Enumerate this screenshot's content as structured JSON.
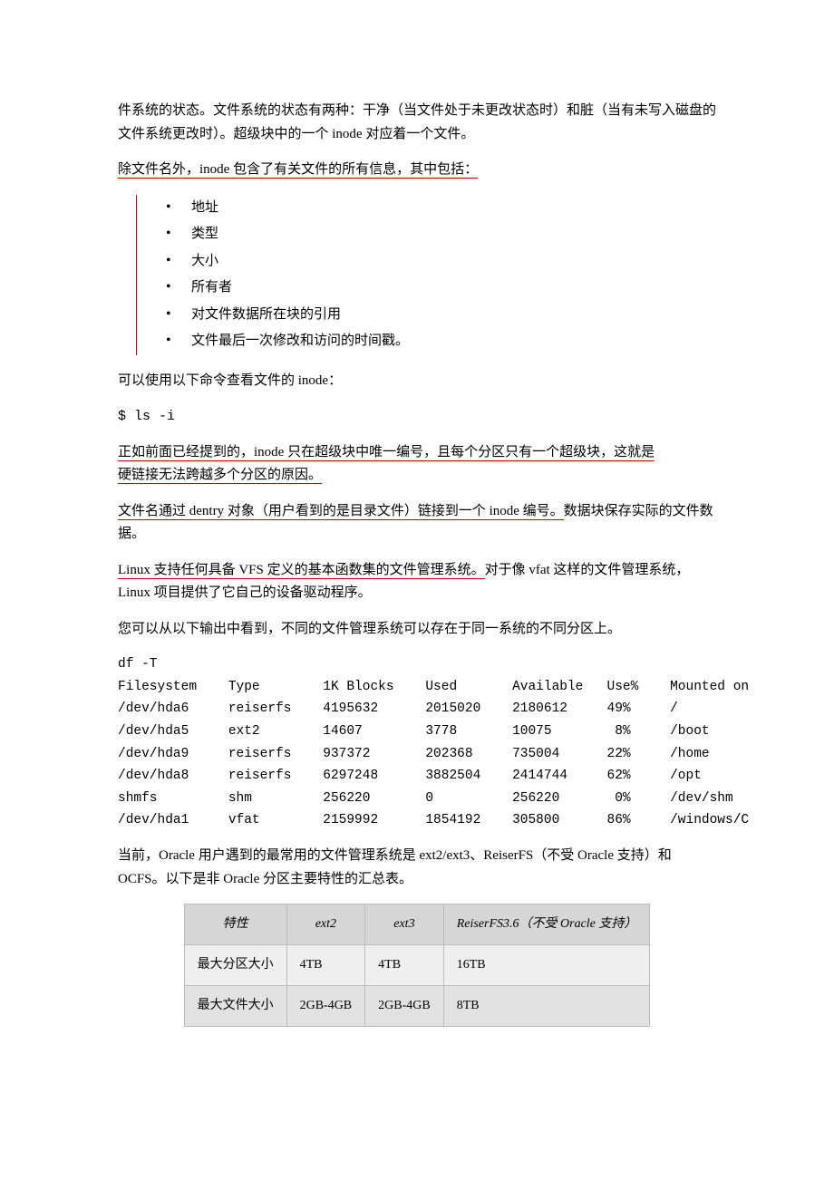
{
  "intro_para": "件系统的状态。文件系统的状态有两种：干净（当文件处于未更改状态时）和脏（当有未写入磁盘的文件系统更改时）。超级块中的一个 inode 对应着一个文件。",
  "inode_heading": "除文件名外，inode 包含了有关文件的所有信息，其中包括：",
  "inode_items": [
    "地址",
    "类型",
    "大小",
    "所有者",
    "对文件数据所在块的引用",
    "文件最后一次修改和访问的时间戳。"
  ],
  "cmd_intro": "可以使用以下命令查看文件的 inode：",
  "cmd_text": "$ ls -i",
  "para_unique_a": "正如前面已经提到的，inode 只在超级块中唯一编号，且每个分区只有一个超级块，这就是",
  "para_unique_b": "硬链接无法跨越多个分区的原因。",
  "para_dentry_a": "文件名通过 dentry 对象（用户看到的是目录文件）链接到一个 inode 编号。",
  "para_dentry_b": "数据块保存实际的文件数据。",
  "para_vfs_a": "Linux 支持任何具备 VFS 定义的基本函数集的文件管理系统。",
  "para_vfs_b": "对于像 vfat 这样的文件管理系统，Linux 项目提供了它自己的设备驱动程序。",
  "para_df_intro": "您可以从以下输出中看到，不同的文件管理系统可以存在于同一系统的不同分区上。",
  "df_output": "df -T\nFilesystem    Type        1K Blocks    Used       Available   Use%    Mounted on\n/dev/hda6     reiserfs    4195632      2015020    2180612     49%     /\n/dev/hda5     ext2        14607        3778       10075        8%     /boot\n/dev/hda9     reiserfs    937372       202368     735004      22%     /home\n/dev/hda8     reiserfs    6297248      3882504    2414744     62%     /opt\nshmfs         shm         256220       0          256220       0%     /dev/shm\n/dev/hda1     vfat        2159992      1854192    305800      86%     /windows/C",
  "para_oracle": "当前，Oracle 用户遇到的最常用的文件管理系统是 ext2/ext3、ReiserFS（不受 Oracle 支持）和 OCFS。以下是非 Oracle 分区主要特性的汇总表。",
  "fs_table": {
    "headers": [
      "特性",
      "ext2",
      "ext3",
      "ReiserFS3.6（不受 Oracle 支持）"
    ],
    "rows": [
      [
        "最大分区大小",
        "4TB",
        "4TB",
        "16TB"
      ],
      [
        "最大文件大小",
        "2GB-4GB",
        "2GB-4GB",
        "8TB"
      ]
    ]
  }
}
